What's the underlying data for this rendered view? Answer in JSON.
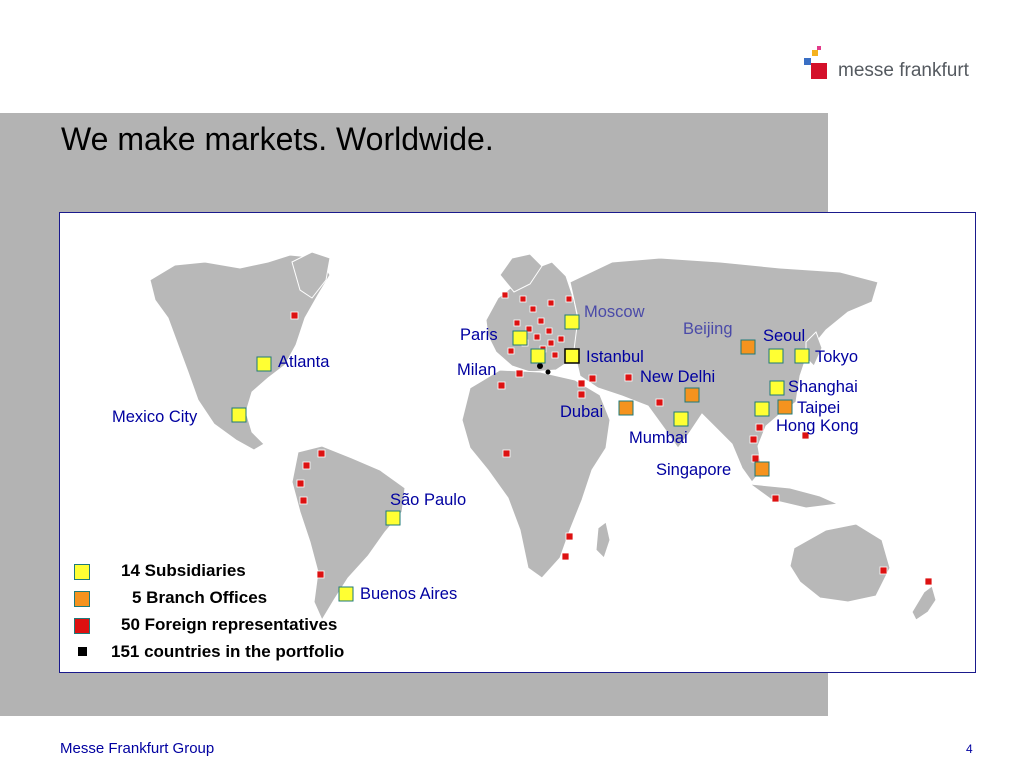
{
  "brand": {
    "logo_text": "messe frankfurt"
  },
  "title": "We make markets. Worldwide.",
  "colors": {
    "subsidiary": "#ffff33",
    "branch": "#f5931e",
    "representative": "#dd1111",
    "country": "#000000",
    "band": "#b3b3b3",
    "text_blue": "#0000a0"
  },
  "cities": {
    "moscow": "Moscow",
    "paris": "Paris",
    "milan": "Milan",
    "istanbul": "Istanbul",
    "beijing": "Beijing",
    "seoul": "Seoul",
    "tokyo": "Tokyo",
    "shanghai": "Shanghai",
    "taipei": "Taipei",
    "hong_kong": "Hong Kong",
    "new_delhi": "New Delhi",
    "dubai": "Dubai",
    "mumbai": "Mumbai",
    "singapore": "Singapore",
    "atlanta": "Atlanta",
    "mexico_city": "Mexico City",
    "sao_paulo": "São Paulo",
    "buenos_aires": "Buenos Aires"
  },
  "legend": {
    "subsidiaries": "14 Subsidiaries",
    "branch_offices": "5 Branch Offices",
    "foreign_reps": "50 Foreign representatives",
    "countries": "151 countries in the portfolio"
  },
  "footer": {
    "company": "Messe Frankfurt Group",
    "page": "4"
  }
}
